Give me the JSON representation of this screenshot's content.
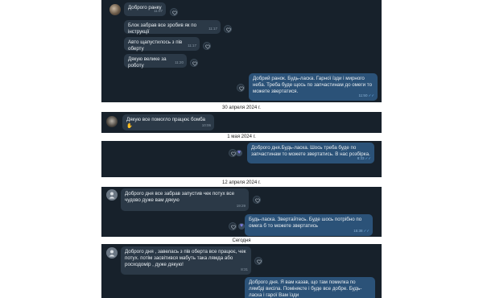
{
  "blocks": [
    {
      "messages": [
        {
          "text": "Доброго ранку",
          "time": "11:07"
        },
        {
          "text": "Блок забрав все зробив як по інструкції",
          "time": "11:17"
        },
        {
          "text": "Авто щапустилось з пів оберту",
          "time": "11:17"
        },
        {
          "text": "Дякую велике за роботу",
          "time": "11:20"
        },
        {
          "text": "Добрий ранок. Будь-ласка. Гарної їзди і мирного неба. Треба буде щось по запчастинам до омеги то можете звертатися.",
          "time": "11:50"
        }
      ]
    },
    {
      "date": "30 апреля 2024 г.",
      "messages": [
        {
          "text": "Дякую все помогло працює бомба",
          "time": "10:06"
        }
      ]
    },
    {
      "date": "1 мая 2024 г.",
      "messages": [
        {
          "text": "Доброго дня.Будь-ласка. Шось треба буде по запчастинам то можете звертатись. В нас розбірка.",
          "time": "8:33"
        }
      ]
    },
    {
      "date": "12 апреля 2024 г.",
      "messages": [
        {
          "text": "Доброго дня все забрав запустив чек потух все чудово дуже вам дякую",
          "time": "19:29"
        },
        {
          "text": "Будь-ласка. Звертайтесь. Буде шось потрібно по омега б то можете звертатись",
          "time": "15:38"
        }
      ]
    },
    {
      "date": "Сегодня",
      "messages": [
        {
          "text": "Доброго дня , завелась з пів оберта все працює, чек потух. потім засвітився мабуть така лямда або росходомір , дуже дякую!",
          "time": "8:31"
        },
        {
          "text": "Доброго дня. Я вам казав, що там помилка по лямбді висіла. Поміняєте і буде все добре. Будь-ласка і гарої Вам їзди",
          "time": ""
        }
      ]
    }
  ],
  "icons": {
    "reaction": "heart-outline-icon",
    "checkmarks": "double-check-icon",
    "avatar_default": "user-silhouette-icon",
    "hand": "waving-hand-icon"
  },
  "colors": {
    "chat_bg": "#17212b",
    "incoming": "#2b3947",
    "outgoing": "#2b5278",
    "text": "#e8edf1"
  }
}
